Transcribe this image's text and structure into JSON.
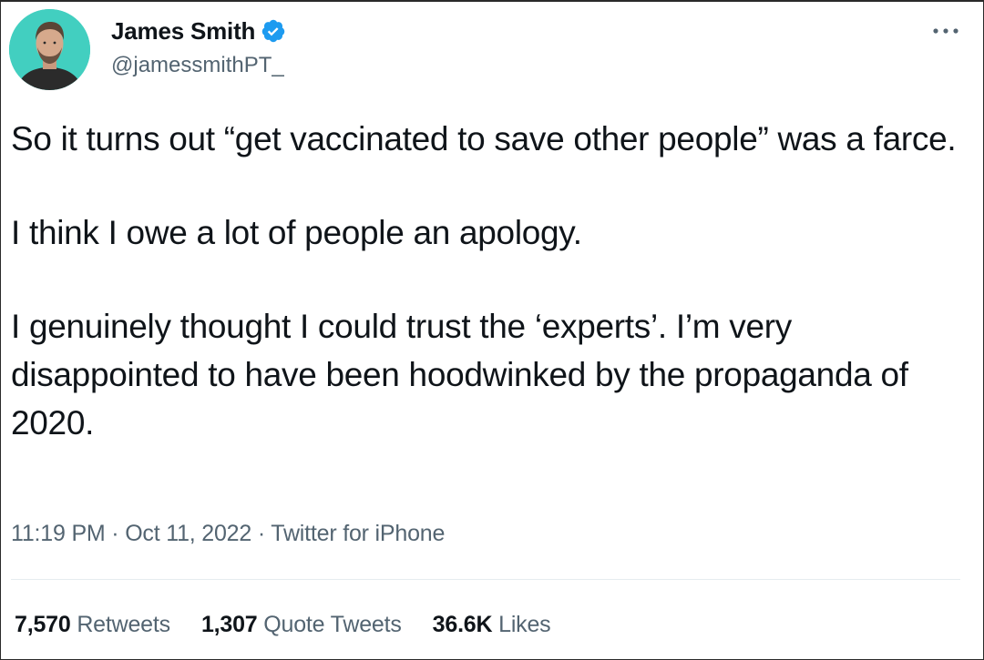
{
  "author": {
    "name": "James Smith",
    "handle": "@jamessmithPT_",
    "verified": true,
    "avatar_bg": "#42cfc0"
  },
  "more_icon": "more-horizontal-icon",
  "tweet": {
    "paragraphs": [
      "So it turns out “get vaccinated to save other people” was a farce.",
      "I think I owe a lot of people an apology.",
      "I genuinely thought I could trust the ‘experts’. I’m very disappointed to have been hoodwinked by the propaganda of 2020."
    ]
  },
  "meta": {
    "time": "11:19 PM",
    "date": "Oct 11, 2022",
    "source": "Twitter for iPhone",
    "separator": " · "
  },
  "stats": {
    "retweets": {
      "count": "7,570",
      "label": "Retweets"
    },
    "quotes": {
      "count": "1,307",
      "label": "Quote Tweets"
    },
    "likes": {
      "count": "36.6K",
      "label": "Likes"
    }
  },
  "colors": {
    "text": "#0f1419",
    "secondary": "#536471",
    "verified": "#1d9bf0",
    "divider": "#e6ecf0"
  }
}
